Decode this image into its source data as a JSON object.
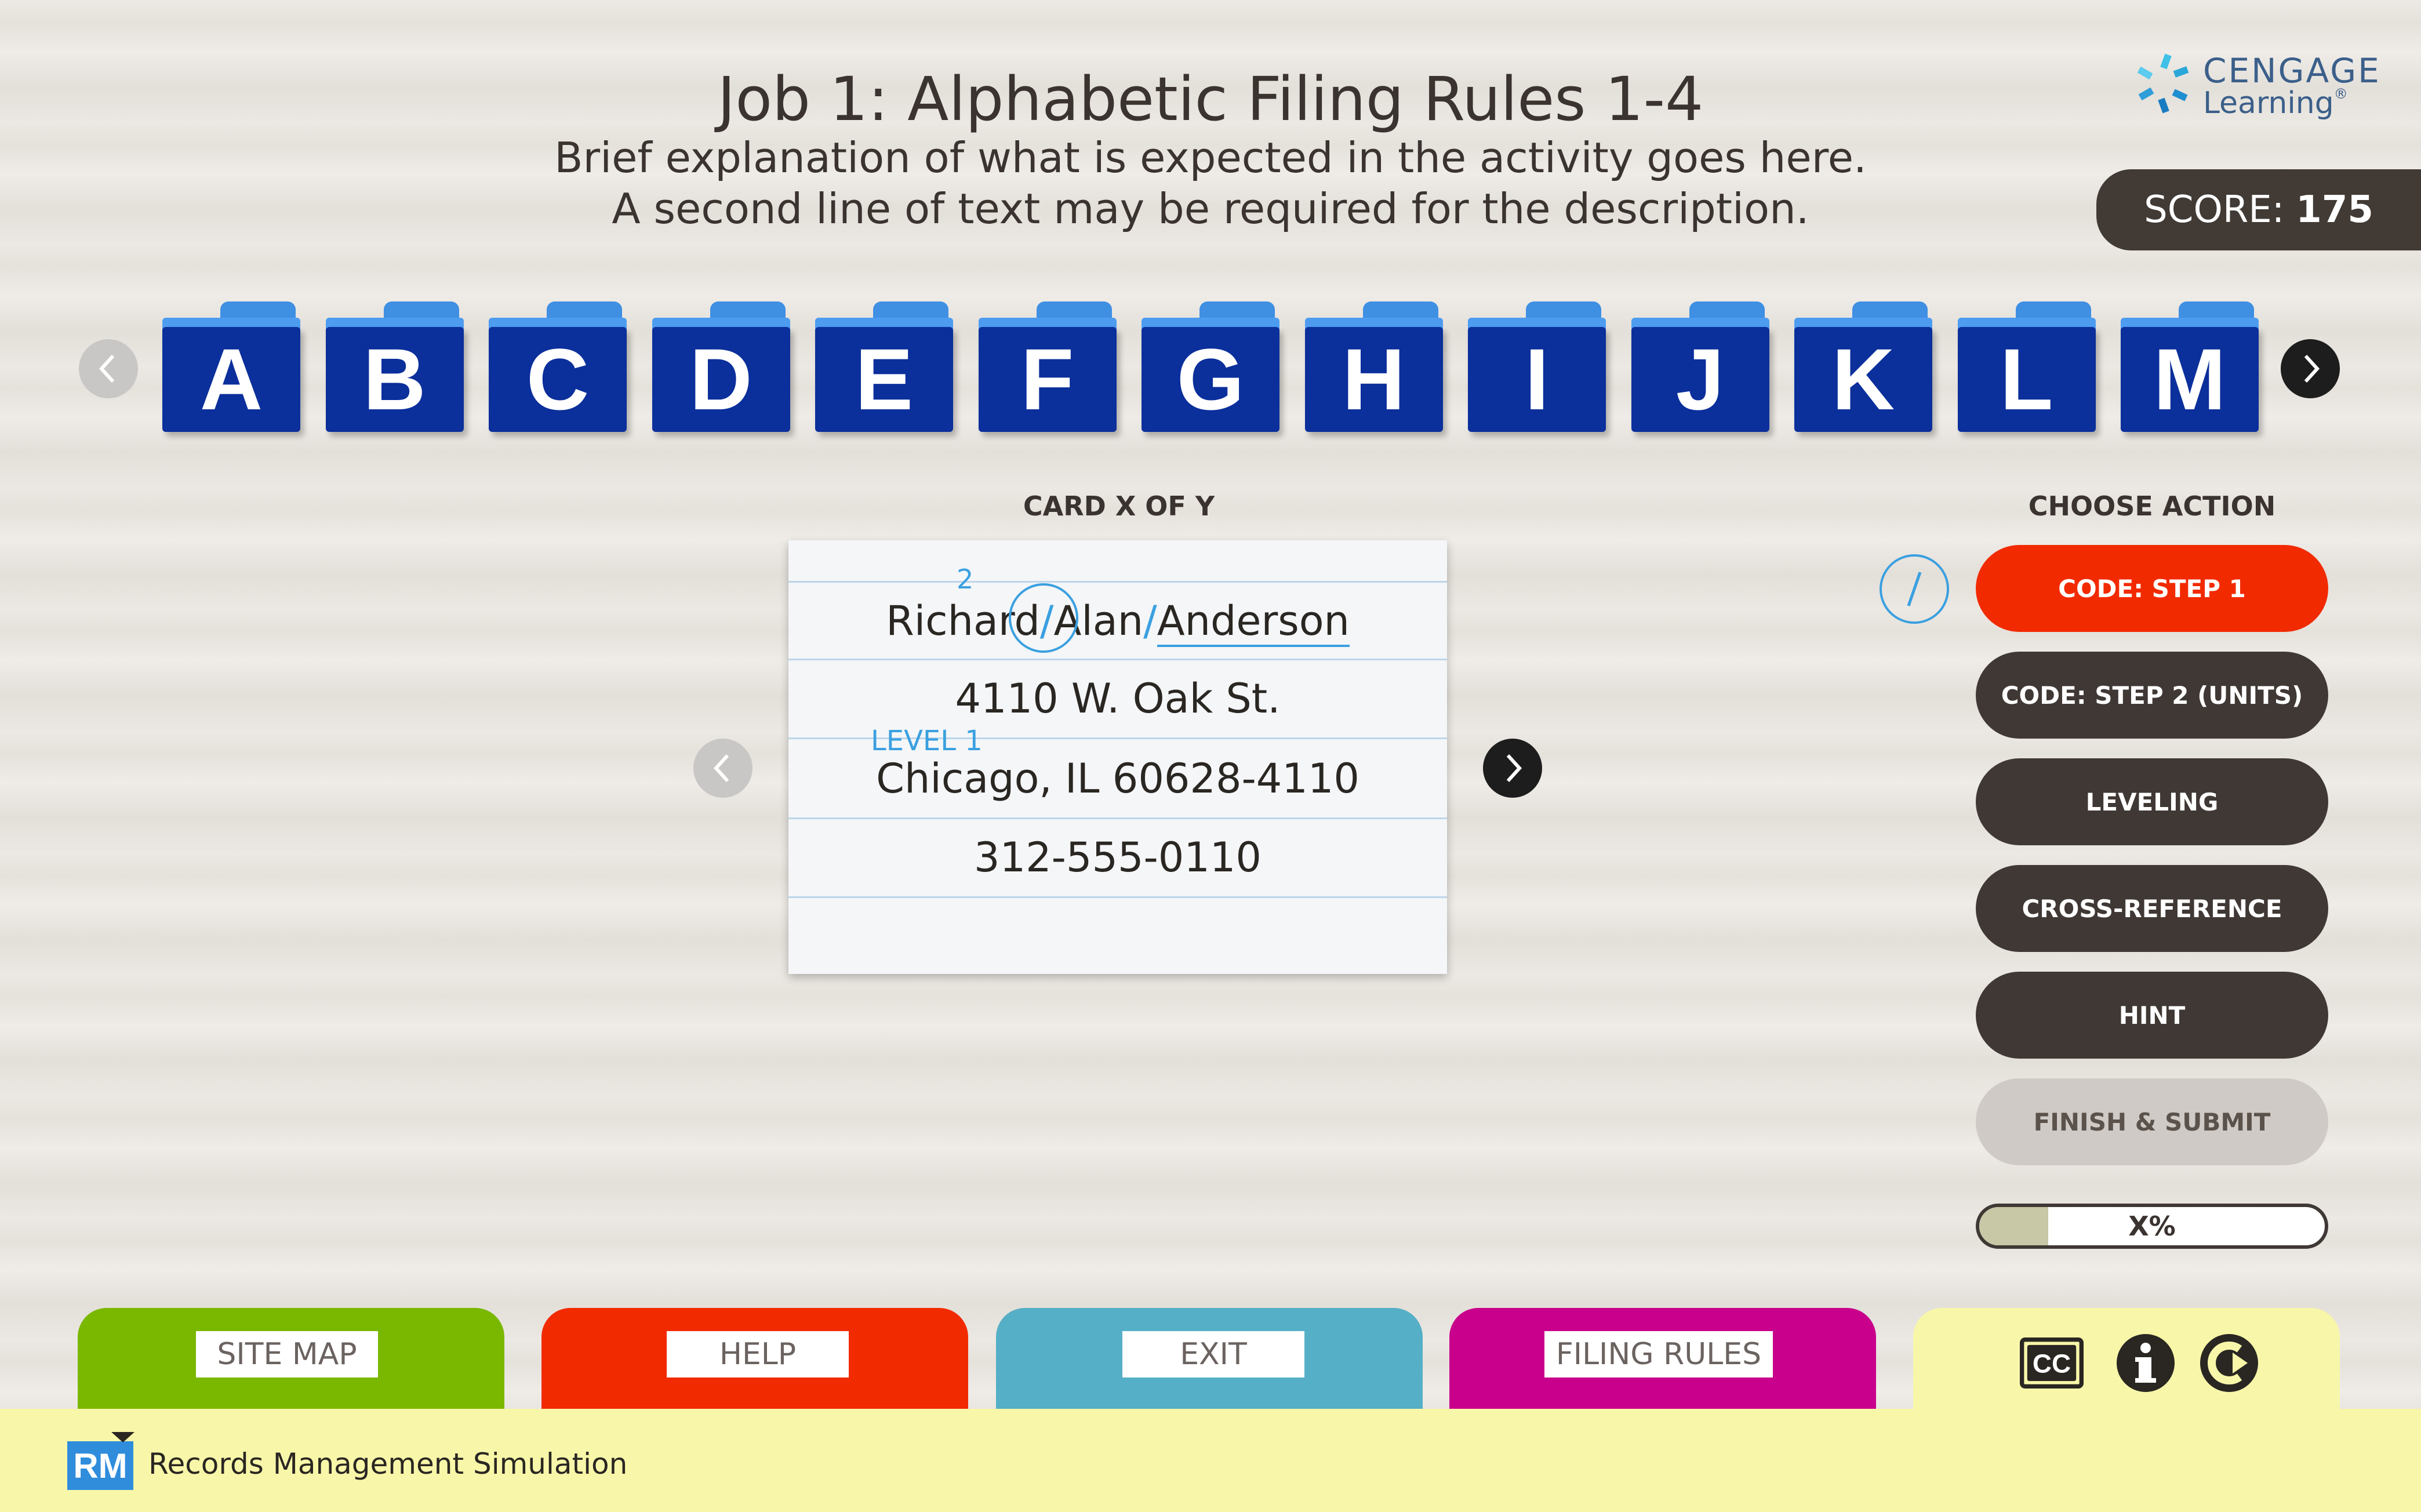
{
  "header": {
    "title": "Job 1: Alphabetic Filing Rules 1-4",
    "description_line1": "Brief explanation of what is expected in the activity goes here.",
    "description_line2": "A second line of text may be required for the description."
  },
  "brand": {
    "name": "CENGAGE",
    "subname": "Learning",
    "trademark": "®"
  },
  "score": {
    "label": "SCORE:",
    "value": "175"
  },
  "folders": [
    "A",
    "B",
    "C",
    "D",
    "E",
    "F",
    "G",
    "H",
    "I",
    "J",
    "K",
    "L",
    "M"
  ],
  "card": {
    "counter": "CARD X OF Y",
    "unit_number": "2",
    "name_first": "Richard",
    "name_middle": "Alan",
    "name_last": "Anderson",
    "separator": "/",
    "address": "4110 W. Oak St.",
    "level_label": "LEVEL 1",
    "city": "Chicago, IL 60628-4110",
    "phone": "312-555-0110"
  },
  "actions": {
    "heading": "CHOOSE ACTION",
    "tool_icon": "slash-tool-icon",
    "code_step1": "CODE: STEP 1",
    "code_step2": "CODE: STEP 2 (UNITS)",
    "leveling": "LEVELING",
    "cross_reference": "CROSS-REFERENCE",
    "hint": "HINT",
    "finish": "FINISH & SUBMIT",
    "progress_label": "X%",
    "progress_fraction": 0.2
  },
  "nav_tabs": {
    "site_map": "SITE MAP",
    "help": "HELP",
    "exit": "EXIT",
    "filing_rules": "FILING RULES"
  },
  "footer": {
    "logo": "RM",
    "app_name": "Records Management Simulation"
  },
  "colors": {
    "folder_blue": "#0b2f9b",
    "action_red": "#f22a00",
    "action_dark": "#3f3834",
    "tab_green": "#7ab800",
    "tab_red": "#f22a00",
    "tab_teal": "#55afc6",
    "tab_magenta": "#c8008c",
    "tab_yellow": "#f8f7a9"
  }
}
